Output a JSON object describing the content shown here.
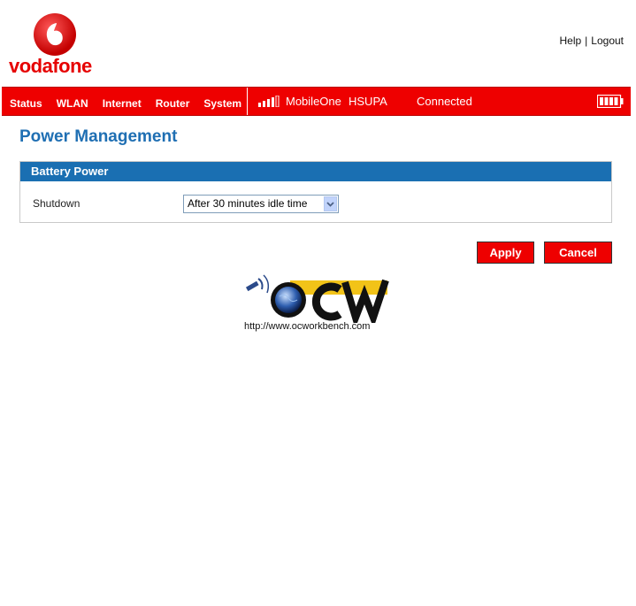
{
  "brand": {
    "name": "vodafone",
    "colors": {
      "red": "#e60000",
      "blue": "#1f6fb3"
    }
  },
  "top_links": {
    "help": "Help",
    "separator": "|",
    "logout": "Logout"
  },
  "nav": {
    "items": [
      "Status",
      "WLAN",
      "Internet",
      "Router",
      "System"
    ],
    "operator": "MobileOne",
    "network": "HSUPA",
    "connection": "Connected",
    "icons": {
      "signal": "signal-bars-icon",
      "battery": "battery-icon"
    }
  },
  "page": {
    "title": "Power Management"
  },
  "panel": {
    "header": "Battery Power",
    "shutdown_label": "Shutdown",
    "shutdown_value": "After 30 minutes idle time"
  },
  "buttons": {
    "apply": "Apply",
    "cancel": "Cancel"
  },
  "watermark": {
    "logo_text": "OCW",
    "url": "http://www.ocworkbench.com"
  }
}
